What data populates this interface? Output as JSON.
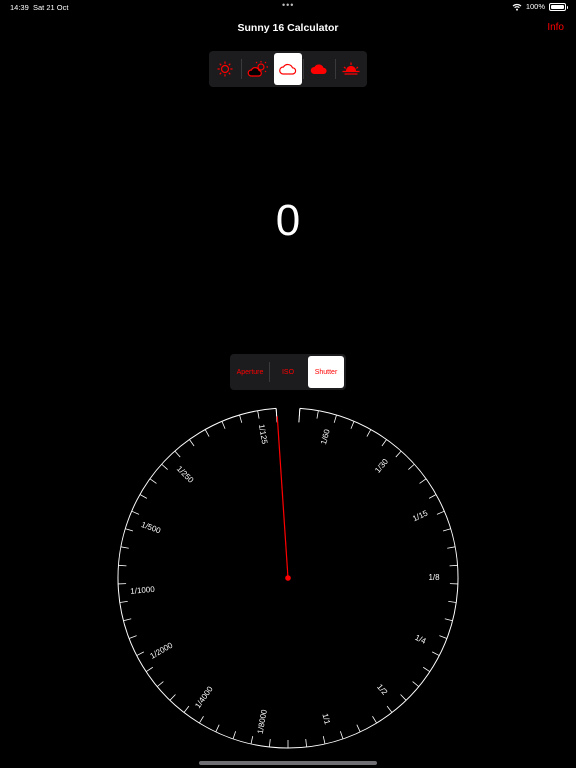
{
  "status_bar": {
    "time": "14:39",
    "date": "Sat 21 Oct",
    "battery": "100%"
  },
  "nav": {
    "title": "Sunny 16 Calculator",
    "info_label": "Info"
  },
  "weather": {
    "selected_index": 2,
    "options": [
      {
        "icon": "sun-icon"
      },
      {
        "icon": "partly-cloudy-icon"
      },
      {
        "icon": "cloud-outline-icon"
      },
      {
        "icon": "cloud-filled-icon"
      },
      {
        "icon": "sunset-icon"
      }
    ]
  },
  "exposure_value": "0",
  "mode": {
    "selected_index": 2,
    "options": [
      "Aperture",
      "ISO",
      "Shutter"
    ]
  },
  "dial": {
    "labels": [
      "1/125",
      "1/60",
      "1/30",
      "1/15",
      "1/8",
      "1/4",
      "1/2",
      "1/1",
      "1/8000",
      "1/4000",
      "1/2000",
      "1/1000",
      "1/500",
      "1/250"
    ],
    "selected": "1/125"
  },
  "colors": {
    "accent": "#ff0000",
    "background": "#000000",
    "segment_bg": "#1c1c1e"
  }
}
